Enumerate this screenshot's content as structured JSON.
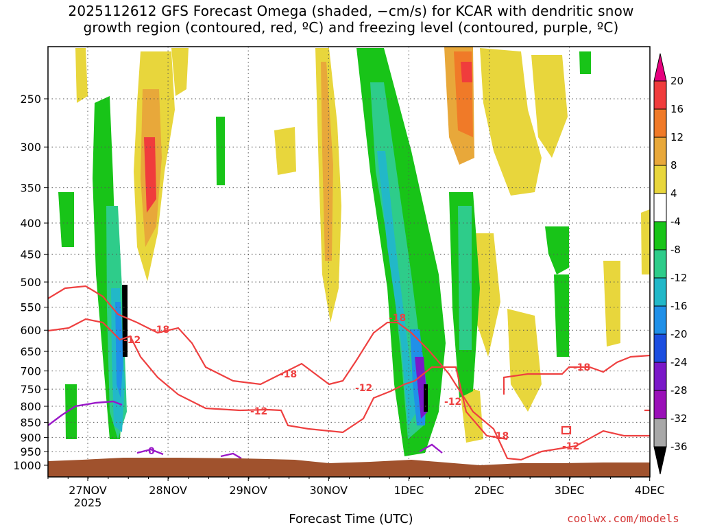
{
  "title_line1": "2025112612 GFS Forecast Omega (shaded, −cm/s) for KCAR with dendritic snow",
  "title_line2": "growth region (contoured, red, ºC) and freezing level (contoured, purple, ºC)",
  "xlabel": "Forecast Time (UTC)",
  "credit": "coolwx.com/models",
  "chart_data": {
    "type": "heatmap",
    "title": "2025112612 GFS Forecast Omega (shaded, −cm/s) for KCAR with dendritic snow growth region (contoured, red, ºC) and freezing level (contoured, purple, ºC)",
    "xlabel": "Forecast Time (UTC)",
    "ylabel": "",
    "x_ticks": [
      "27NOV",
      "28NOV",
      "29NOV",
      "30NOV",
      "1DEC",
      "2DEC",
      "3DEC",
      "4DEC"
    ],
    "x_tick_sub": "2025",
    "y_ticks": [
      250,
      300,
      350,
      400,
      450,
      500,
      550,
      600,
      650,
      700,
      750,
      800,
      850,
      900,
      950,
      1000
    ],
    "y_scale": "log-pressure (inverted)",
    "colorbar_ticks": [
      20,
      16,
      12,
      8,
      4,
      -4,
      -8,
      -12,
      -16,
      -20,
      -24,
      -28,
      -32,
      -36
    ],
    "colorbar_colors": [
      "#e6007e",
      "#f03c3c",
      "#f07a28",
      "#e8a83a",
      "#e8d63c",
      "#ffffff",
      "#18c418",
      "#2ecc8a",
      "#22b8c8",
      "#2090e8",
      "#1c4ee0",
      "#7a18c8",
      "#9a10b8",
      "#a8a8a8",
      "#000000"
    ],
    "contours": [
      {
        "label": "-12",
        "color": "red"
      },
      {
        "label": "-18",
        "color": "red"
      },
      {
        "label": "0",
        "color": "purple"
      }
    ],
    "grid": true
  }
}
